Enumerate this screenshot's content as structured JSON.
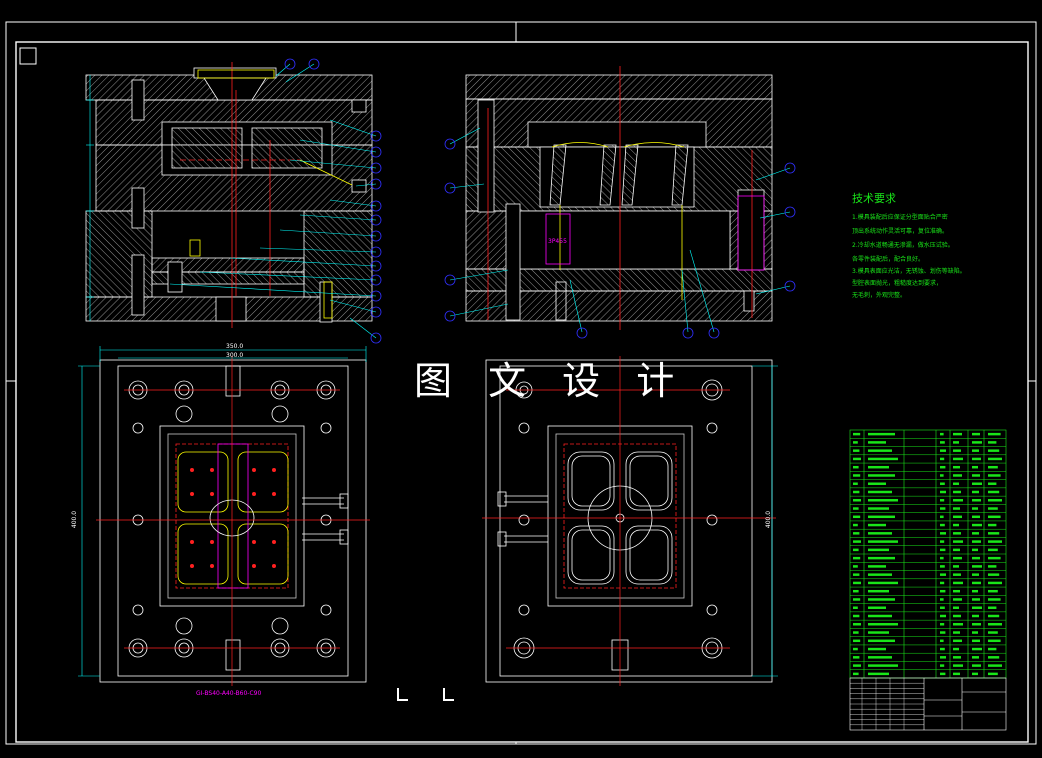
{
  "watermark": "图 文 设 计",
  "tech_requirements": {
    "title": "技术要求",
    "lines": [
      "1.模具装配后应保证分型面贴合严密",
      "顶出系统动作灵活可靠，复位准确。",
      "2.冷却水道畅通无渗漏，做水压试验。",
      "各零件装配后，配合良好。",
      "3.模具表面应光洁，无锈蚀、划伤等缺陷。",
      "型腔表面抛光，粗糙度达到要求，",
      "无毛刺，外观完整。"
    ]
  },
  "dimensions": {
    "width_outer": "350.0",
    "width_inner": "300.0",
    "height_left": "400.0",
    "height_right": "400.0"
  },
  "bottom_label": "GI-BS40-A40-B60-C90",
  "cavity_tag": "3P455",
  "colors": {
    "background": "#000000",
    "line": "#ffffff",
    "dimension": "#00ffff",
    "leader": "#00ffff",
    "balloon": "#3030ff",
    "centerline": "#ff2020",
    "hatch": "#c8c8c8",
    "component": "#ffff00",
    "bom": "#19e619",
    "bom_mark": "#00ff00",
    "tag": "#ff00ff"
  },
  "title_block": {
    "rows": 10
  }
}
